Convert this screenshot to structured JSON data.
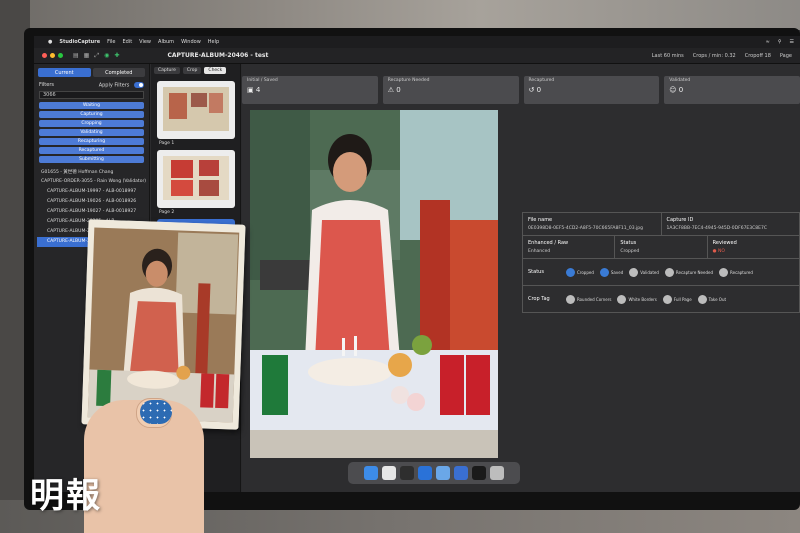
{
  "menubar": {
    "app_name": "StudioCapture",
    "items": [
      "File",
      "Edit",
      "View",
      "Album",
      "Window",
      "Help"
    ]
  },
  "window": {
    "title": "CAPTURE-ALBUM-20406 - test",
    "status_left": "Last 60 mins",
    "status_crops": "Crops / min: 0.32",
    "status_cropoff": "Cropoff 18",
    "status_right": "Page"
  },
  "left_panel": {
    "tabs": [
      "Current",
      "Completed"
    ],
    "filters_label": "Filters",
    "apply_filters_label": "Apply Filters",
    "search_value": "3066",
    "statuses": [
      "Waiting",
      "Capturing",
      "Cropping",
      "Validating",
      "Recapturing",
      "Recaptured",
      "Submitting"
    ],
    "tree": [
      {
        "label": "G01655 - 黃世德 Hoffman Chang",
        "level": 1,
        "selected": false
      },
      {
        "label": "CAPTURE-ORDER-3055 - Rain Wong (Validator)",
        "level": 1,
        "selected": false
      },
      {
        "label": "CAPTURE-ALBUM-19997 - ALB-0018997",
        "level": 2,
        "selected": false
      },
      {
        "label": "CAPTURE-ALBUM-19026 - ALB-0018926",
        "level": 2,
        "selected": false
      },
      {
        "label": "CAPTURE-ALBUM-19027 - ALB-0018927",
        "level": 2,
        "selected": false
      },
      {
        "label": "CAPTURE-ALBUM-20385 - ALB-...",
        "level": 2,
        "selected": false
      },
      {
        "label": "CAPTURE-ALBUM-20386 - ALB-...",
        "level": 2,
        "selected": false
      },
      {
        "label": "CAPTURE-ALBUM-20406 -",
        "level": 2,
        "selected": true
      }
    ]
  },
  "thumbs": {
    "tabs": [
      "Capture",
      "Crop",
      "Check"
    ],
    "pages": [
      {
        "label": "Page 1"
      },
      {
        "label": "Page 2"
      }
    ]
  },
  "stat_cards": [
    {
      "label": "Initial / Saved",
      "value": "4"
    },
    {
      "label": "Recapture Needed",
      "value": "0"
    },
    {
      "label": "Recaptured",
      "value": "0"
    },
    {
      "label": "Validated",
      "value": "0"
    }
  ],
  "info": {
    "file_name_key": "File name",
    "file_name_val": "0E0398D8-0EF5-4CD2-A8F5-70C665FA8F11_03.jpg",
    "capture_id_key": "Capture ID",
    "capture_id_val": "1A3CF8BB-7EC4-4945-945D-0DF67E3C8E7C",
    "enhanced_key": "Enhanced / Raw",
    "enhanced_val": "Enhanced",
    "status_key": "Status",
    "status_val": "Cropped",
    "reviewed_key": "Reviewed",
    "reviewed_val": "NO",
    "status_row_label": "Status",
    "status_chips": [
      "Cropped",
      "Saved",
      "Validated",
      "Recapture Needed",
      "Recaptured"
    ],
    "crop_tag_label": "Crop Tag",
    "crop_tags": [
      "Rounded Corners",
      "White Borders",
      "Full Page",
      "Take Out"
    ]
  },
  "watermark": "明報",
  "colors": {
    "accent": "#3a6fd1",
    "reviewed_no": "#e05b4b",
    "sprite_can": "#1f7a3a",
    "coke_can": "#c8202a"
  }
}
